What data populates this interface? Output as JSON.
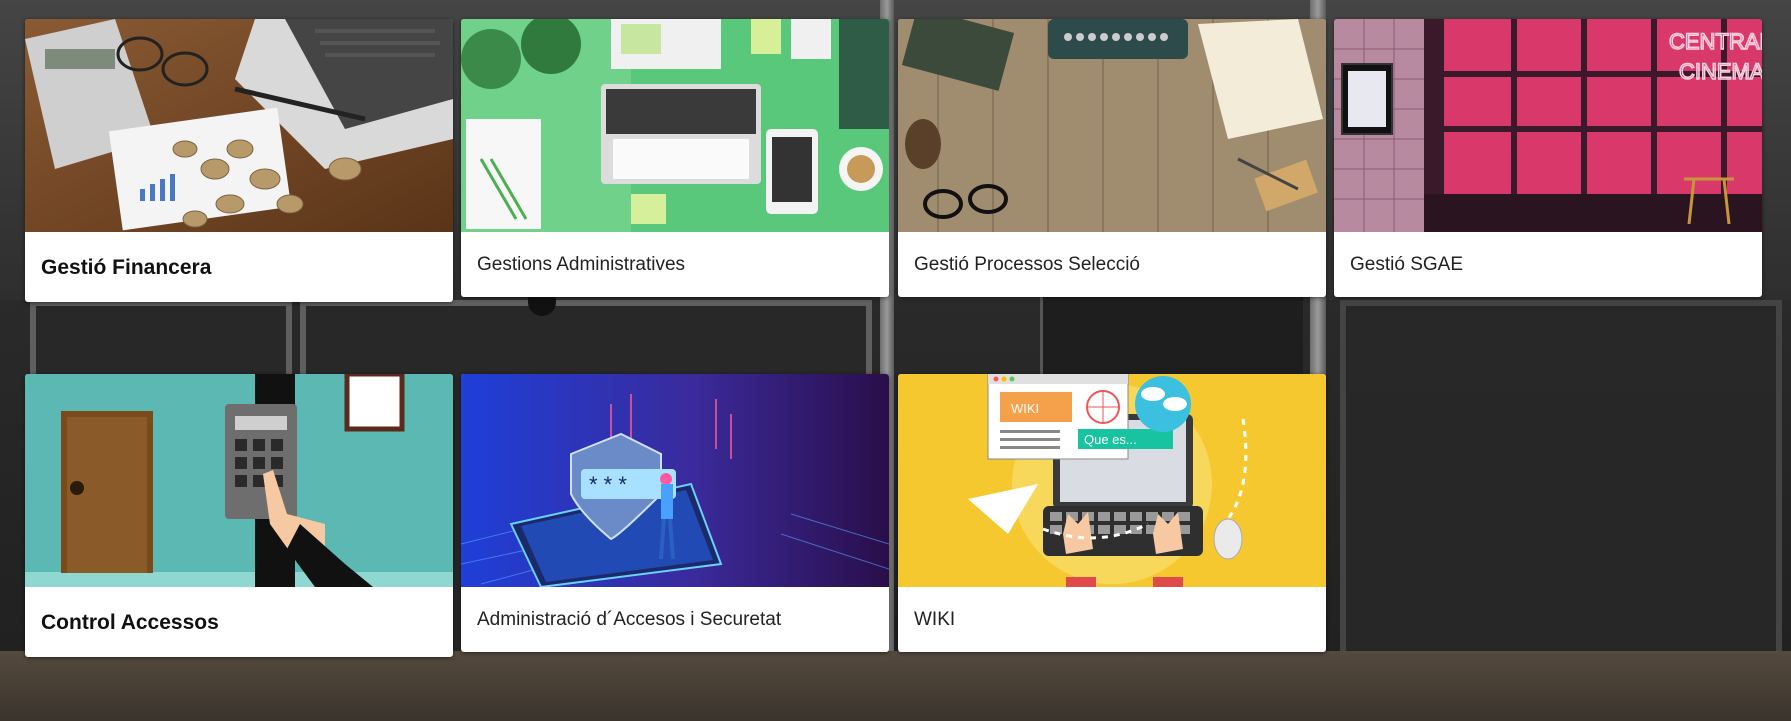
{
  "cards": [
    {
      "title": "Gestió Financera",
      "image": "finance-desk-coins-laptop"
    },
    {
      "title": "Gestions Administratives",
      "image": "green-desk-laptop-stationery"
    },
    {
      "title": "Gestió Processos Selecció",
      "image": "wooden-desk-typewriter"
    },
    {
      "title": "Gestió SGAE",
      "image": "central-cinema-neon"
    },
    {
      "title": "Control Accessos",
      "image": "door-keypad-illustration"
    },
    {
      "title": "Administració d´Accesos i Securetat",
      "image": "security-shield-phone-illustration"
    },
    {
      "title": "WIKI",
      "image": "wiki-computer-illustration"
    }
  ],
  "image_text": {
    "cinema_sign": [
      "CENTRAL",
      "CINEMA"
    ],
    "wiki_label": "WIKI",
    "wiki_search": "Que es..."
  }
}
